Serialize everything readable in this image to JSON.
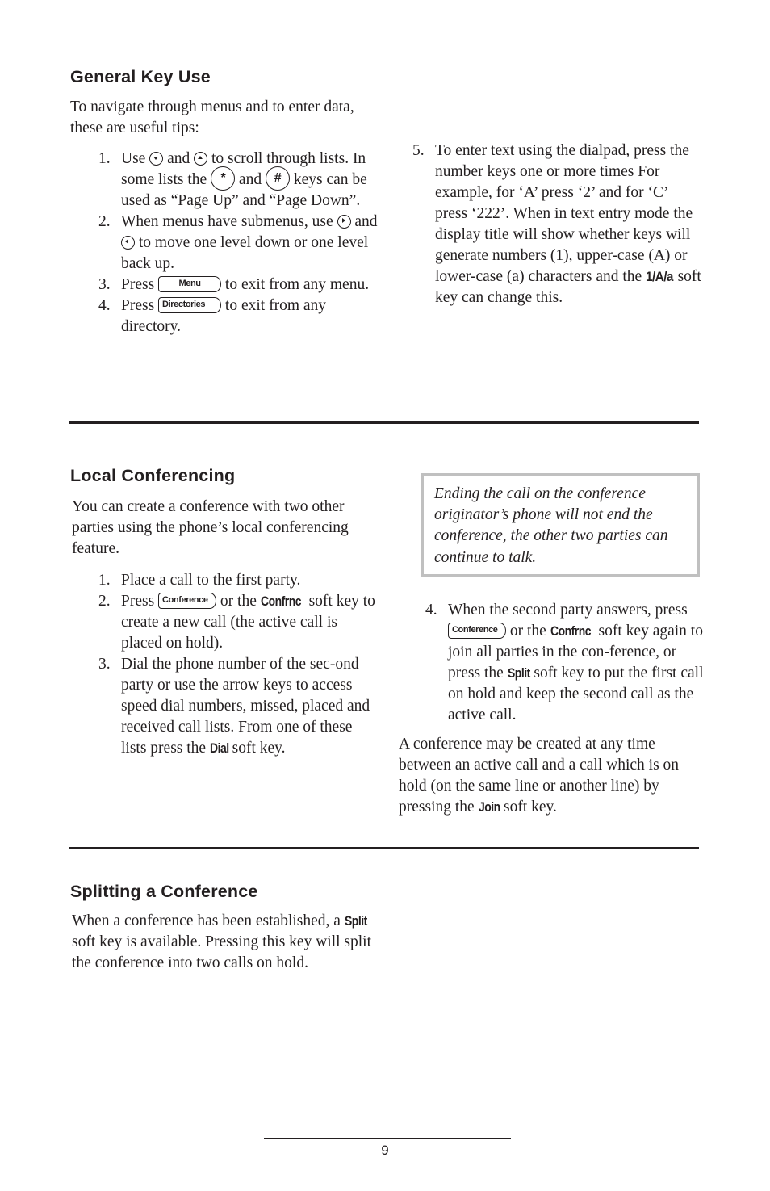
{
  "page_number": "9",
  "general_key_use": {
    "heading": "General Key Use",
    "intro": "To navigate through menus and to enter data, these are useful tips:",
    "items": {
      "i1": {
        "num": "1.",
        "t1": "Use ",
        "icon1": "scroll-down-key-icon",
        "t2": " and ",
        "icon2": "scroll-up-key-icon",
        "t3": " to scroll through lists. In some lists the ",
        "key_star": "*",
        "t4": " and ",
        "key_hash": "#",
        "t5": " keys can be used as “Page Up” and “Page Down”."
      },
      "i2": {
        "num": "2.",
        "t1": "When menus have submenus, use ",
        "icon1": "right-arrow-key-icon",
        "t2": " and ",
        "icon2": "left-arrow-key-icon",
        "t3": " to move one level down or one level back up."
      },
      "i3": {
        "num": "3.",
        "t1": "Press ",
        "key": "Menu",
        "t2": " to exit from any menu."
      },
      "i4": {
        "num": "4.",
        "t1": "Press ",
        "key": "Directories",
        "t2": " to exit from any directory."
      },
      "i5": {
        "num": "5.",
        "t1": "To enter text using the dialpad, press the number keys one or more times For example, for ‘A’ press ‘2’ and for ‘C’ press ‘222’.  When in text entry mode the display title will show whether keys will generate numbers (1), upper-case (A) or lower-case (a) characters and the ",
        "softkey": "1/A/a",
        "t2": " soft key can change this."
      }
    }
  },
  "local_conferencing": {
    "heading": "Local Conferencing",
    "intro": "You can create a conference with two other parties using the phone’s local conferencing feature.",
    "items": {
      "i1": {
        "num": "1.",
        "t1": "Place a call to the first party."
      },
      "i2": {
        "num": "2.",
        "t1": "Press ",
        "key": "Conference",
        "t2": " or the ",
        "softkey": "Confrnc",
        "t3": " soft key to create a new call (the active call is placed on hold)."
      },
      "i3": {
        "num": "3.",
        "t1": "Dial the phone number of the sec-ond party or use the arrow keys to access speed dial numbers, missed, placed and received call lists.  From one of these lists press the ",
        "softkey": "Dial",
        "t2": " soft key."
      },
      "i4": {
        "num": "4.",
        "t1": "When the second party answers, press ",
        "key": "Conference",
        "t2": " or the ",
        "softkey1": "Confrnc",
        "t3": " soft key again to join all parties in the con-ference, or press the ",
        "softkey2": "Split",
        "t4": " soft key to put the first call on hold and keep the second call as the active call."
      }
    },
    "note": "Ending the call on the conference originator’s phone will not end the conference, the other two parties can continue to talk.",
    "closing": {
      "t1": "A conference may be created at any time between an active call and a call which is on hold (on the same line or another line) by pressing the ",
      "softkey": "Join",
      "t2": " soft key."
    }
  },
  "splitting": {
    "heading": "Splitting a Conference",
    "t1": "When a conference has been established, a ",
    "softkey": "Split",
    "t2": " soft key is available.  Pressing this key will split the conference into two calls on hold."
  }
}
